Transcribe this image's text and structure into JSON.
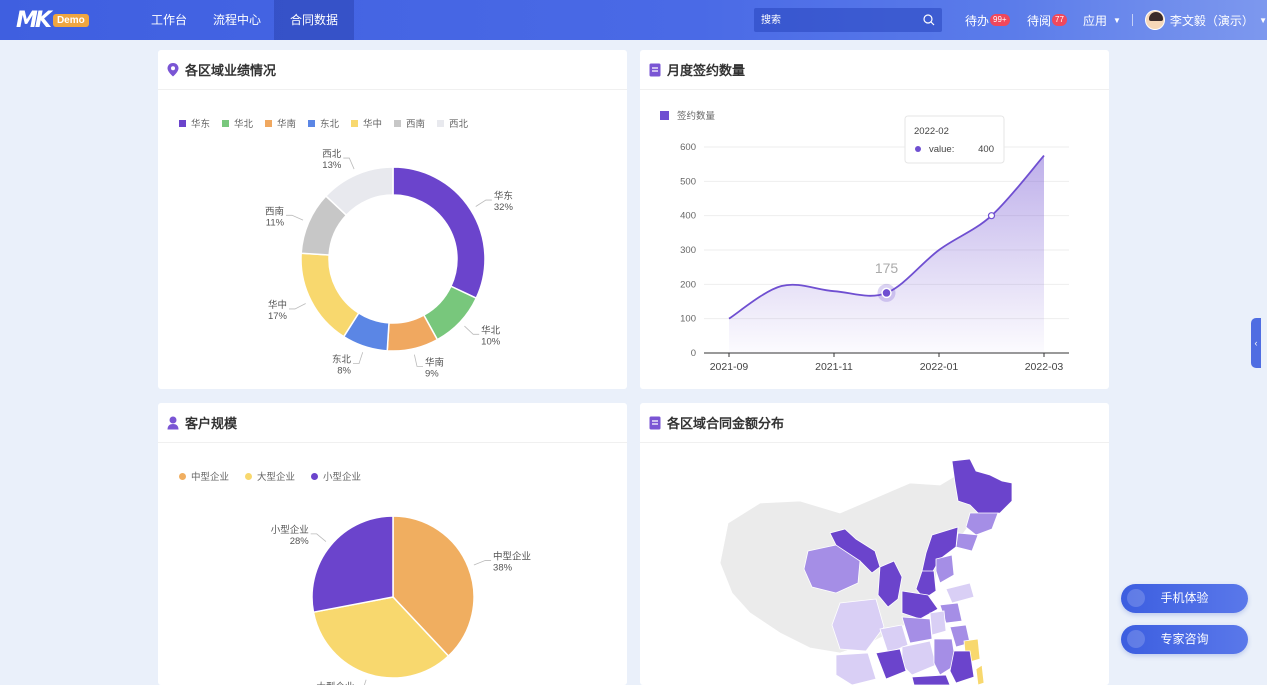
{
  "brand": {
    "logo_text": "MK",
    "badge": "Demo"
  },
  "nav": {
    "items": [
      {
        "label": "工作台"
      },
      {
        "label": "流程中心"
      },
      {
        "label": "合同数据"
      }
    ]
  },
  "search": {
    "placeholder": "搜索"
  },
  "header": {
    "todo_label": "待办",
    "todo_count": "99+",
    "toread_label": "待阅",
    "toread_count": "77",
    "apps_label": "应用",
    "user_name": "李文毅（演示）"
  },
  "cards": {
    "region_perf": {
      "title": "各区域业绩情况"
    },
    "monthly_sign": {
      "title": "月度签约数量"
    },
    "customer_scale": {
      "title": "客户规模"
    },
    "region_contract": {
      "title": "各区域合同金额分布"
    }
  },
  "chart_data": [
    {
      "id": "region-donut",
      "type": "pie",
      "variant": "donut",
      "legend_position": "top-left",
      "categories": [
        "华东",
        "华北",
        "华南",
        "东北",
        "华中",
        "西南",
        "西北"
      ],
      "values": [
        32,
        10,
        9,
        8,
        17,
        11,
        13
      ],
      "value_labels": [
        "32%",
        "10%",
        "9%",
        "8%",
        "17%",
        "11%",
        "13%"
      ],
      "colors": [
        "#6b44cc",
        "#78c77c",
        "#f0a860",
        "#5b86e5",
        "#f8d86e",
        "#c7c7c7",
        "#e8e9ee"
      ]
    },
    {
      "id": "monthly-line",
      "type": "line",
      "legend": [
        "签约数量"
      ],
      "x_ticks": [
        "2021-09",
        "2021-11",
        "2022-01",
        "2022-03"
      ],
      "x": [
        "2021-09",
        "2021-10",
        "2021-11",
        "2021-12",
        "2022-01",
        "2022-02",
        "2022-03"
      ],
      "series": [
        {
          "name": "签约数量",
          "values": [
            100,
            195,
            180,
            175,
            300,
            400,
            575
          ]
        }
      ],
      "ylim": [
        0,
        600
      ],
      "y_ticks": [
        0,
        100,
        200,
        300,
        400,
        500,
        600
      ],
      "color": "#6f4fd1",
      "highlight": {
        "label": "175"
      },
      "tooltip": {
        "title": "2022-02",
        "key": "value:",
        "value": "400"
      }
    },
    {
      "id": "customer-pie",
      "type": "pie",
      "legend_position": "top-left",
      "categories": [
        "中型企业",
        "大型企业",
        "小型企业"
      ],
      "values": [
        38,
        34,
        28
      ],
      "value_labels": [
        "38%",
        "34%",
        "28%"
      ],
      "colors": [
        "#f0ae60",
        "#f8d86e",
        "#6b44cc"
      ]
    },
    {
      "id": "region-map",
      "type": "map",
      "region": "China",
      "colors": {
        "high": "#6b44cc",
        "mid": "#a58ee6",
        "low": "#d9cff5",
        "none": "#ebebeb",
        "special": "#f8d86e"
      }
    }
  ],
  "floats": {
    "mobile": "手机体验",
    "consult": "专家咨询"
  }
}
